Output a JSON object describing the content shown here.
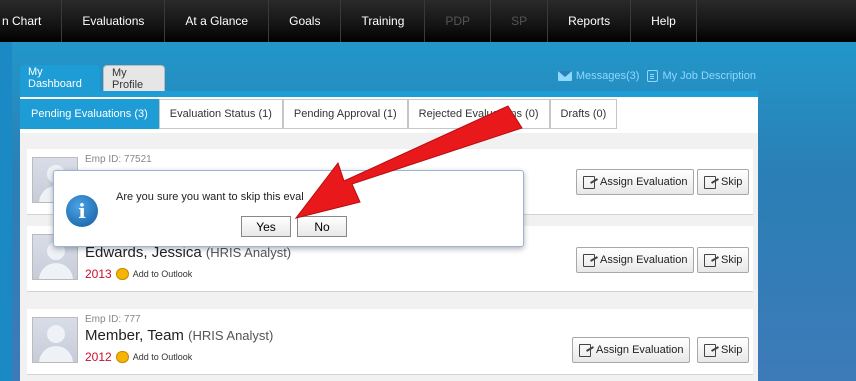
{
  "nav": {
    "items": [
      {
        "label": "n Chart",
        "disabled": false
      },
      {
        "label": "Evaluations",
        "disabled": false
      },
      {
        "label": "At a Glance",
        "disabled": false
      },
      {
        "label": "Goals",
        "disabled": false
      },
      {
        "label": "Training",
        "disabled": false
      },
      {
        "label": "PDP",
        "disabled": true
      },
      {
        "label": "SP",
        "disabled": true
      },
      {
        "label": "Reports",
        "disabled": false
      },
      {
        "label": "Help",
        "disabled": false
      }
    ]
  },
  "header": {
    "tabs": [
      {
        "label": "My Dashboard",
        "active": true
      },
      {
        "label": "My Profile",
        "active": false
      }
    ],
    "messages_label": "Messages(3)",
    "job_description_label": "My Job Description"
  },
  "subtabs": [
    {
      "label": "Pending Evaluations (3)",
      "active": true
    },
    {
      "label": "Evaluation Status (1)",
      "active": false
    },
    {
      "label": "Pending Approval (1)",
      "active": false
    },
    {
      "label": "Rejected Evaluations (0)",
      "active": false
    },
    {
      "label": "Drafts (0)",
      "active": false
    }
  ],
  "rows": [
    {
      "emp_id": "Emp ID: 77521",
      "name": "",
      "role": "",
      "year": "",
      "outlook": ""
    },
    {
      "emp_id": "",
      "name": "Edwards, Jessica",
      "role": "(HRIS Analyst)",
      "year": "2013",
      "outlook": "Add to Outlook"
    },
    {
      "emp_id": "Emp ID: 777",
      "name": "Member, Team",
      "role": "(HRIS Analyst)",
      "year": "2012",
      "outlook": "Add to Outlook"
    }
  ],
  "buttons": {
    "assign": "Assign Evaluation",
    "skip": "Skip"
  },
  "dialog": {
    "message": "Are you sure you want to skip this eval",
    "message_tail": "d?",
    "yes": "Yes",
    "no": "No"
  },
  "colors": {
    "accent": "#1e9cd6",
    "arrow": "#e8181b",
    "year": "#c8102e"
  }
}
